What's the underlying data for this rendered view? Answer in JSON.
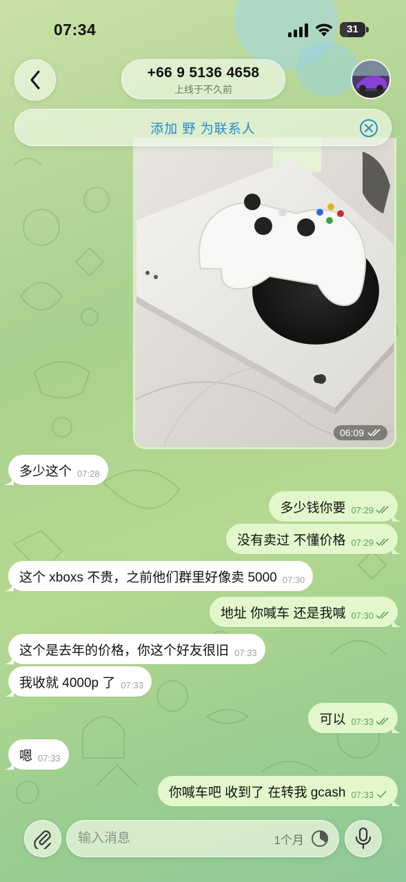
{
  "status_bar": {
    "time": "07:34",
    "battery": "31"
  },
  "header": {
    "contact_name": "+66 9 5136 4658",
    "contact_status": "上线于不久前",
    "add_contact_label": "添加 野 为联系人"
  },
  "photo_message": {
    "time": "06:09"
  },
  "messages": [
    {
      "dir": "in",
      "text": "多少这个",
      "time": "07:28"
    },
    {
      "dir": "out",
      "text": "多少钱你要",
      "time": "07:29"
    },
    {
      "dir": "out",
      "text": "没有卖过  不懂价格",
      "time": "07:29"
    },
    {
      "dir": "in",
      "text": "这个 xboxs 不贵，之前他们群里好像卖 5000",
      "time": "07:30"
    },
    {
      "dir": "out",
      "text": "地址 你喊车  还是我喊",
      "time": "07:30"
    },
    {
      "dir": "in",
      "text": "这个是去年的价格，你这个好友很旧",
      "time": "07:33"
    },
    {
      "dir": "in",
      "text": "我收就 4000p 了",
      "time": "07:33"
    },
    {
      "dir": "out",
      "text": "可以",
      "time": "07:33"
    },
    {
      "dir": "in",
      "text": "嗯",
      "time": "07:33"
    },
    {
      "dir": "out",
      "text": "你喊车吧 收到了 在转我 gcash",
      "time": "07:33",
      "single_check": true
    }
  ],
  "input_bar": {
    "placeholder": "输入消息",
    "timer_label": "1个月"
  },
  "colors": {
    "accent": "#2a8ac9",
    "outgoing_bubble": "#e2f7cb",
    "incoming_bubble": "#ffffff",
    "check": "#5ea456"
  }
}
